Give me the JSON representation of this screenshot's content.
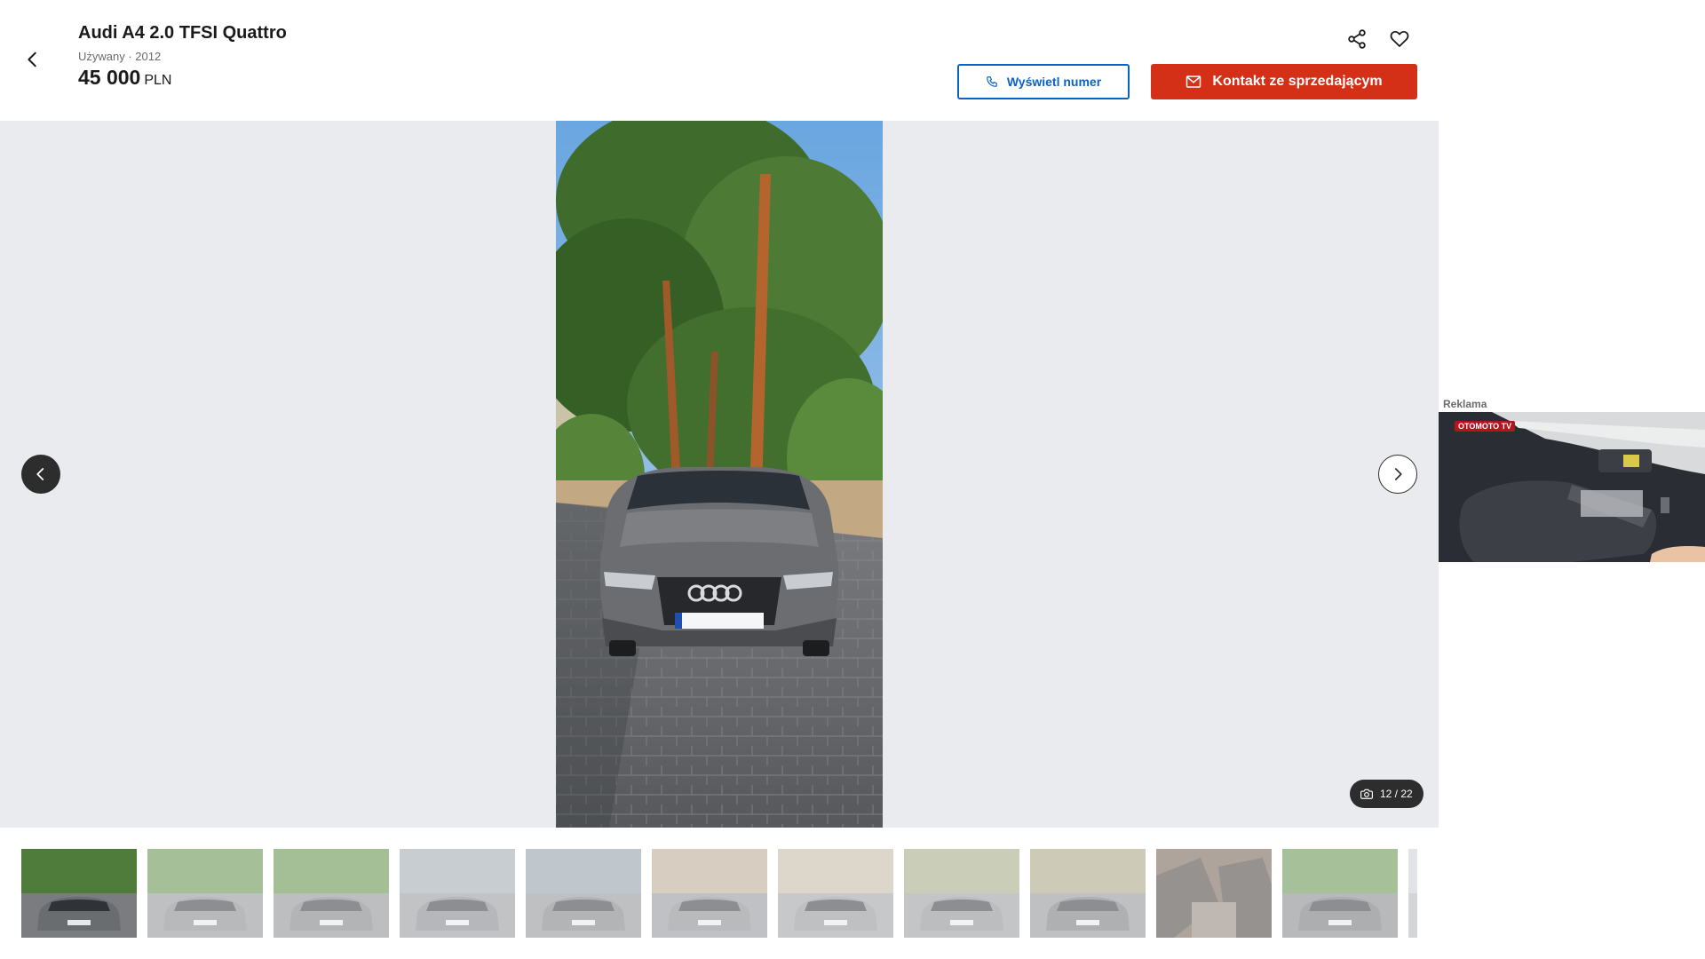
{
  "listing": {
    "title": "Audi A4 2.0 TFSI Quattro",
    "subtitle": "Używany · 2012",
    "price_amount": "45 000",
    "price_currency": "PLN"
  },
  "actions": {
    "phone_label": "Wyświetl numer",
    "contact_label": "Kontakt ze sprzedającym"
  },
  "icons": {
    "back": "chevron-left-icon",
    "share": "share-icon",
    "favorite": "heart-icon",
    "phone": "phone-icon",
    "mail": "mail-icon",
    "camera": "camera-icon",
    "prev": "chevron-left-icon",
    "next": "chevron-right-icon"
  },
  "gallery": {
    "counter": "12 / 22",
    "current_index": 12,
    "total": 22
  },
  "thumbnails": [
    {
      "id": 1,
      "faded": false
    },
    {
      "id": 2,
      "faded": true
    },
    {
      "id": 3,
      "faded": true
    },
    {
      "id": 4,
      "faded": true
    },
    {
      "id": 5,
      "faded": true
    },
    {
      "id": 6,
      "faded": true
    },
    {
      "id": 7,
      "faded": true
    },
    {
      "id": 8,
      "faded": true
    },
    {
      "id": 9,
      "faded": true
    },
    {
      "id": 10,
      "faded": true
    },
    {
      "id": 11,
      "faded": true
    },
    {
      "id": 12,
      "faded": true
    }
  ],
  "ad": {
    "label": "Reklama",
    "logo_text": "OTOMOTO TV"
  },
  "colors": {
    "accent_blue": "#0a63c4",
    "accent_red": "#d42f17",
    "gallery_bg": "#e9ebef",
    "dark": "#2d2d2d"
  }
}
